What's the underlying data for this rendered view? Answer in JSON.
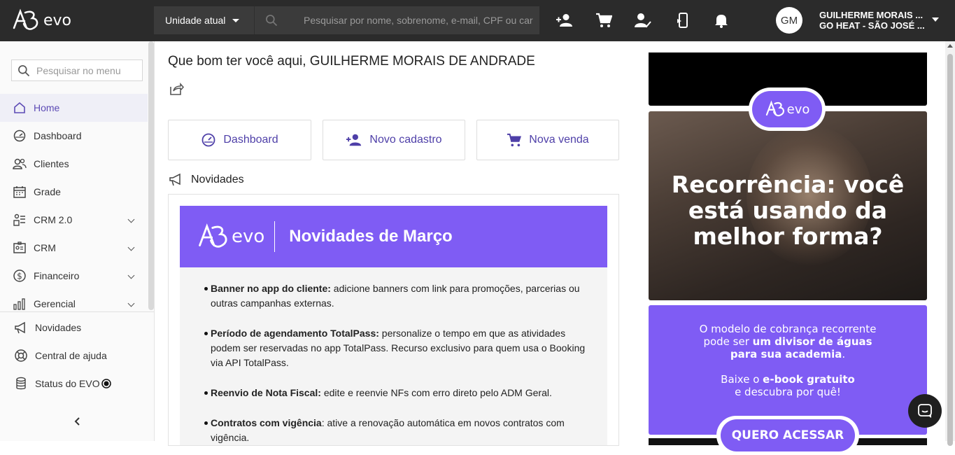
{
  "header": {
    "logo_text": "evo",
    "unit_select": "Unidade atual",
    "search_placeholder": "Pesquisar por nome, sobrenome, e-mail, CPF ou car",
    "icons": [
      "add-person-icon",
      "cart-icon",
      "person-check-icon",
      "mobile-sync-icon",
      "bell-icon"
    ],
    "avatar_initials": "GM",
    "user_name": "GUILHERME MORAIS ...",
    "user_unit": "GO HEAT - SÃO JOSÉ ..."
  },
  "sidebar": {
    "search_placeholder": "Pesquisar no menu",
    "items": [
      {
        "label": "Home",
        "icon": "home-icon",
        "active": true
      },
      {
        "label": "Dashboard",
        "icon": "speedometer-icon"
      },
      {
        "label": "Clientes",
        "icon": "people-icon"
      },
      {
        "label": "Grade",
        "icon": "calendar-icon"
      },
      {
        "label": "CRM 2.0",
        "icon": "crm-icon",
        "expandable": true
      },
      {
        "label": "CRM",
        "icon": "contact-card-icon",
        "expandable": true
      },
      {
        "label": "Financeiro",
        "icon": "dollar-icon",
        "expandable": true
      },
      {
        "label": "Gerencial",
        "icon": "bar-chart-icon",
        "expandable": true
      }
    ],
    "bottom_items": [
      {
        "label": "Novidades",
        "icon": "megaphone-icon"
      },
      {
        "label": "Central de ajuda",
        "icon": "help-ring-icon"
      },
      {
        "label": "Status do EVO",
        "icon": "database-icon"
      }
    ]
  },
  "main": {
    "welcome": "Que bom ter você aqui, GUILHERME MORAIS DE ANDRADE",
    "quick_actions": [
      "Dashboard",
      "Novo cadastro",
      "Nova venda"
    ],
    "news_heading": "Novidades",
    "news_banner": {
      "logo": "evo",
      "title": "Novidades de Março"
    },
    "news_items": [
      {
        "title": "Banner no app do cliente:",
        "text": " adicione banners com link para promoções, parcerias ou outras campanhas externas."
      },
      {
        "title": "Período de agendamento TotalPass:",
        "text": " personalize o tempo em que as atividades podem ser reservadas no app TotalPass. Recurso exclusivo para quem usa o Booking via API TotalPass."
      },
      {
        "title": "Reenvio de Nota Fiscal:",
        "text": " edite e reenvie NFs com erro direto pelo ADM Geral."
      },
      {
        "title": "Contratos com vigência",
        "text": ": ative a renovação automática em novos contratos com vigência."
      }
    ]
  },
  "ads": {
    "badge": "evo",
    "headline": "Recorrência: você está usando da melhor forma?",
    "promo_line1_a": "O modelo de cobrança recorrente pode ser ",
    "promo_line1_b": "um divisor de águas para sua academia",
    "promo_line1_c": ".",
    "promo_line2_a": "Baixe o ",
    "promo_line2_b": "e-book gratuito",
    "promo_line2_c": " e descubra por quê!",
    "cta": "QUERO ACESSAR"
  },
  "colors": {
    "accent": "#7f5cf4",
    "topbar": "#2b2b2b",
    "active_text": "#5d4bb5"
  }
}
